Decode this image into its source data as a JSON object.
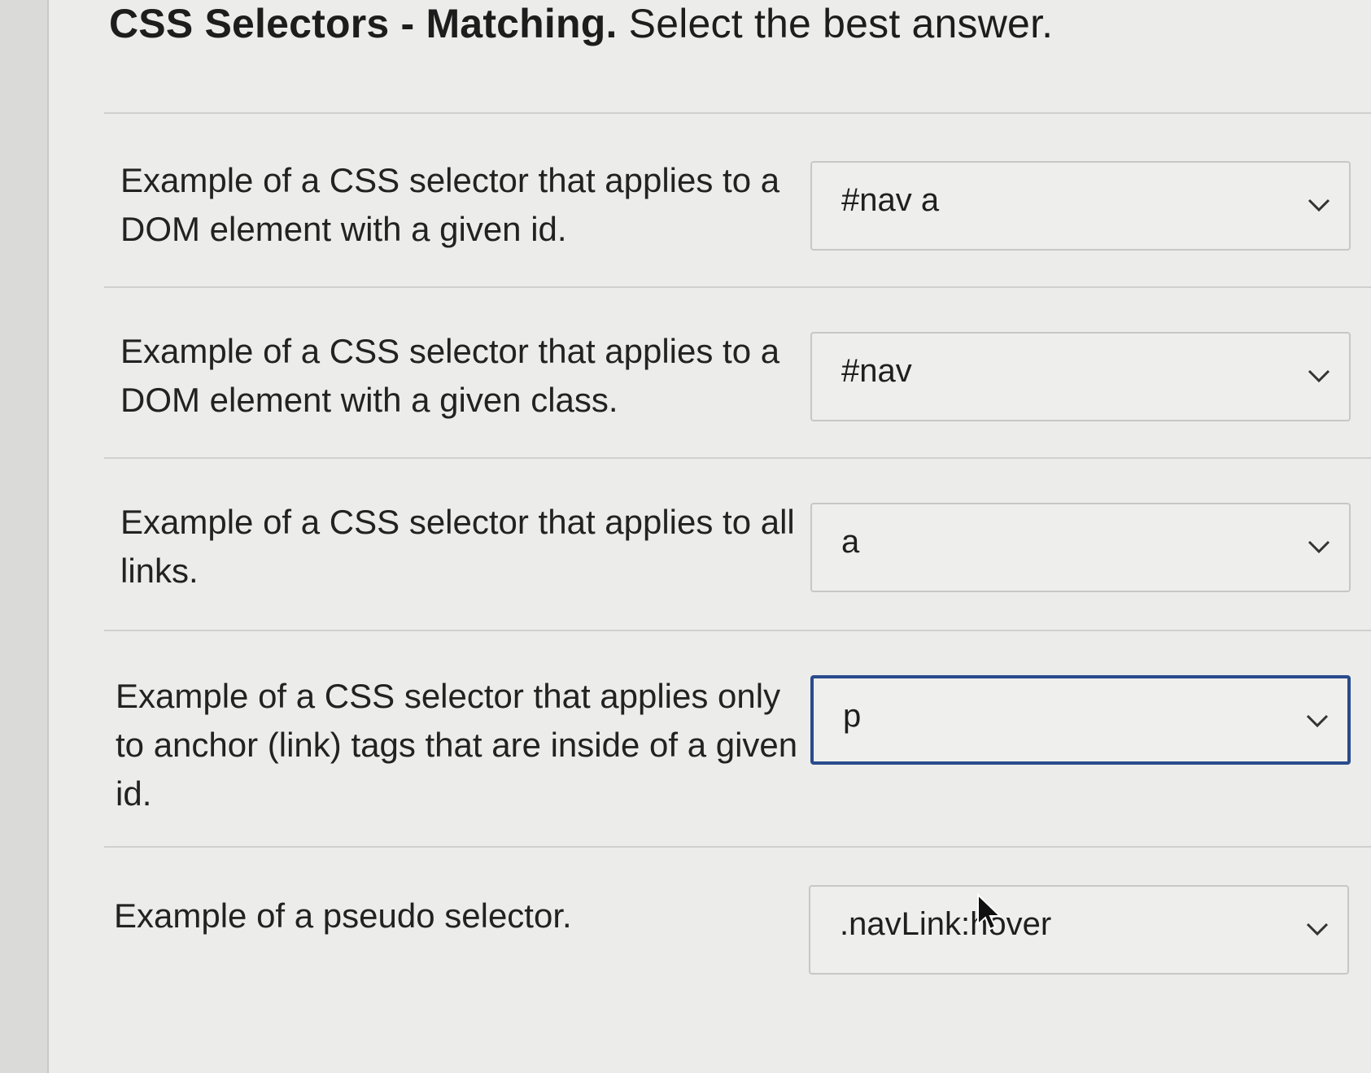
{
  "page": {
    "title_strong": "CSS Selectors - Matching.",
    "title_rest": " Select the best answer."
  },
  "items": [
    {
      "prompt": "Example of a CSS selector that applies to a DOM element with a given id.",
      "selected": "#nav a",
      "focused": false
    },
    {
      "prompt": "Example of a CSS selector that applies to a DOM element with a given class.",
      "selected": "#nav",
      "focused": false
    },
    {
      "prompt": "Example of a CSS selector that applies to all links.",
      "selected": "a",
      "focused": false
    },
    {
      "prompt": "Example of a CSS selector that applies only to anchor (link) tags that are inside of a given id.",
      "selected": "p",
      "focused": true
    },
    {
      "prompt": "Example of a pseudo selector.",
      "selected": ".navLink:hover",
      "focused": false
    }
  ],
  "icons": {
    "dropdown": "chevron-down-icon",
    "pointer": "mouse-pointer-icon"
  },
  "colors": {
    "focus_border": "#2a4b8d",
    "divider": "#d0d0ce",
    "text": "#222222"
  }
}
